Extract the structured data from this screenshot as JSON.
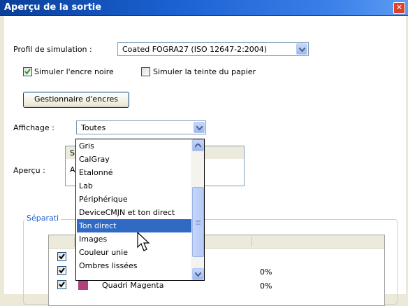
{
  "window": {
    "title": "Aperçu de la sortie",
    "close_glyph": "✕"
  },
  "simulation": {
    "label": "Profil de simulation :",
    "value": "Coated FOGRA27 (ISO 12647-2:2004)"
  },
  "checkboxes": {
    "black_ink": {
      "label": "Simuler l'encre noire",
      "checked": true
    },
    "paper_tint": {
      "label": "Simuler la teinte du papier",
      "checked": false
    }
  },
  "ink_manager_button": "Gestionnaire d'encres",
  "display": {
    "label": "Affichage :",
    "value": "Toutes",
    "options": [
      "Gris",
      "CalGray",
      "Etalonné",
      "Lab",
      "Périphérique",
      "DeviceCMJN et ton direct",
      "Ton direct",
      "Images",
      "Couleur unie",
      "Ombres lissées"
    ],
    "selected_index": 6
  },
  "preview": {
    "label": "Aperçu :",
    "header_fragment": "S",
    "row_fragment": "A"
  },
  "separations": {
    "group_title": "Séparati",
    "rows": [
      {
        "checked": true,
        "name": "",
        "value": ""
      },
      {
        "checked": true,
        "name": "",
        "value": "0%"
      },
      {
        "checked": true,
        "name": "Quadri Magenta",
        "value": "0%",
        "swatch": "#b2407a"
      }
    ]
  },
  "colors": {
    "selection": "#316ac5",
    "accent_title": "#1f5fcc",
    "magenta": "#b2407a",
    "titlebar": "#0a3f99"
  }
}
